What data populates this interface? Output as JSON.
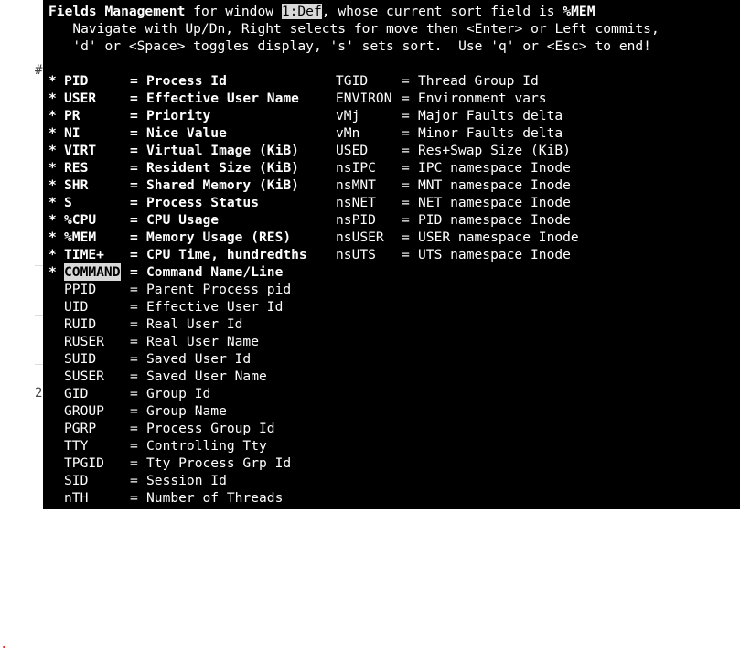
{
  "header": {
    "title_bold": "Fields Management",
    "title_mid": " for window ",
    "window_name": "1:Def",
    "title_after": ", whose current sort field is ",
    "sort_field": "%MEM",
    "help_line1": "   Navigate with Up/Dn, Right selects for move then <Enter> or Left commits,",
    "help_line2": "   'd' or <Space> toggles display, 's' sets sort.  Use 'q' or <Esc> to end!"
  },
  "fields_left": [
    {
      "mark": "*",
      "name": "PID",
      "eq": "=",
      "desc": "Process Id",
      "active": true
    },
    {
      "mark": "*",
      "name": "USER",
      "eq": "=",
      "desc": "Effective User Name",
      "active": true
    },
    {
      "mark": "*",
      "name": "PR",
      "eq": "=",
      "desc": "Priority",
      "active": true
    },
    {
      "mark": "*",
      "name": "NI",
      "eq": "=",
      "desc": "Nice Value",
      "active": true
    },
    {
      "mark": "*",
      "name": "VIRT",
      "eq": "=",
      "desc": "Virtual Image (KiB)",
      "active": true
    },
    {
      "mark": "*",
      "name": "RES",
      "eq": "=",
      "desc": "Resident Size (KiB)",
      "active": true
    },
    {
      "mark": "*",
      "name": "SHR",
      "eq": "=",
      "desc": "Shared Memory (KiB)",
      "active": true
    },
    {
      "mark": "*",
      "name": "S",
      "eq": "=",
      "desc": "Process Status",
      "active": true
    },
    {
      "mark": "*",
      "name": "%CPU",
      "eq": "=",
      "desc": "CPU Usage",
      "active": true
    },
    {
      "mark": "*",
      "name": "%MEM",
      "eq": "=",
      "desc": "Memory Usage (RES)",
      "active": true
    },
    {
      "mark": "*",
      "name": "TIME+",
      "eq": "=",
      "desc": "CPU Time, hundredths",
      "active": true
    },
    {
      "mark": "*",
      "name": "COMMAND",
      "eq": "=",
      "desc": "Command Name/Line",
      "active": true,
      "selected": true
    },
    {
      "mark": "",
      "name": "PPID",
      "eq": "=",
      "desc": "Parent Process pid",
      "active": false
    },
    {
      "mark": "",
      "name": "UID",
      "eq": "=",
      "desc": "Effective User Id",
      "active": false
    },
    {
      "mark": "",
      "name": "RUID",
      "eq": "=",
      "desc": "Real User Id",
      "active": false
    },
    {
      "mark": "",
      "name": "RUSER",
      "eq": "=",
      "desc": "Real User Name",
      "active": false
    },
    {
      "mark": "",
      "name": "SUID",
      "eq": "=",
      "desc": "Saved User Id",
      "active": false
    },
    {
      "mark": "",
      "name": "SUSER",
      "eq": "=",
      "desc": "Saved User Name",
      "active": false
    },
    {
      "mark": "",
      "name": "GID",
      "eq": "=",
      "desc": "Group Id",
      "active": false
    },
    {
      "mark": "",
      "name": "GROUP",
      "eq": "=",
      "desc": "Group Name",
      "active": false
    },
    {
      "mark": "",
      "name": "PGRP",
      "eq": "=",
      "desc": "Process Group Id",
      "active": false
    },
    {
      "mark": "",
      "name": "TTY",
      "eq": "=",
      "desc": "Controlling Tty",
      "active": false
    },
    {
      "mark": "",
      "name": "TPGID",
      "eq": "=",
      "desc": "Tty Process Grp Id",
      "active": false
    },
    {
      "mark": "",
      "name": "SID",
      "eq": "=",
      "desc": "Session Id",
      "active": false
    },
    {
      "mark": "",
      "name": "nTH",
      "eq": "=",
      "desc": "Number of Threads",
      "active": false
    }
  ],
  "fields_right": [
    {
      "name": "TGID",
      "eq": "=",
      "desc": "Thread Group Id"
    },
    {
      "name": "ENVIRON",
      "eq": "=",
      "desc": "Environment vars"
    },
    {
      "name": "vMj",
      "eq": "=",
      "desc": "Major Faults delta"
    },
    {
      "name": "vMn",
      "eq": "=",
      "desc": "Minor Faults delta"
    },
    {
      "name": "USED",
      "eq": "=",
      "desc": "Res+Swap Size (KiB)"
    },
    {
      "name": "nsIPC",
      "eq": "=",
      "desc": "IPC namespace Inode"
    },
    {
      "name": "nsMNT",
      "eq": "=",
      "desc": "MNT namespace Inode"
    },
    {
      "name": "nsNET",
      "eq": "=",
      "desc": "NET namespace Inode"
    },
    {
      "name": "nsPID",
      "eq": "=",
      "desc": "PID namespace Inode"
    },
    {
      "name": "nsUSER",
      "eq": "=",
      "desc": "USER namespace Inode"
    },
    {
      "name": "nsUTS",
      "eq": "=",
      "desc": "UTS namespace Inode"
    }
  ],
  "background_glyphs": [
    "#",
    "2"
  ],
  "colors": {
    "terminal_bg": "#000000",
    "terminal_fg": "#ffffff",
    "highlight_bg": "#d8d8d8",
    "highlight_fg": "#000000"
  }
}
